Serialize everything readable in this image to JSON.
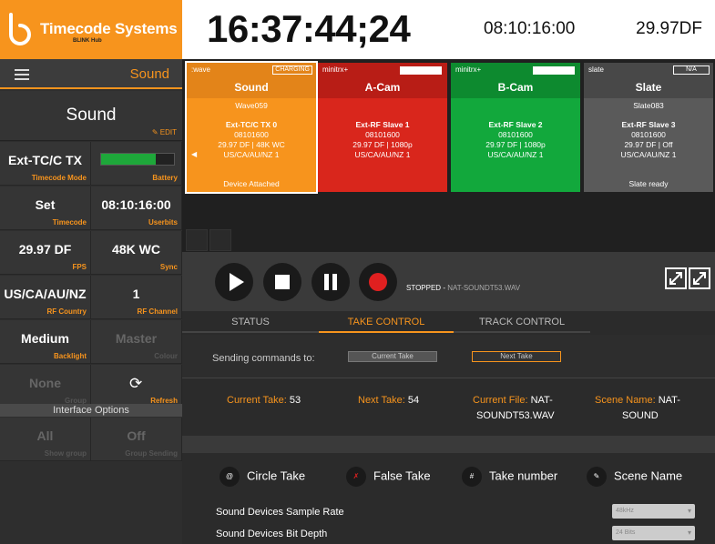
{
  "brand": {
    "name": "Timecode Systems",
    "sub": "BLINK Hub",
    "color": "#f7941d"
  },
  "header": {
    "menu_title": "Sound"
  },
  "device": {
    "name": "Sound",
    "edit_label": "✎ EDIT"
  },
  "settings": [
    {
      "value": "Ext-TC/C TX",
      "label": "Timecode Mode"
    },
    {
      "value": "",
      "label": "Battery",
      "battery_level": 0.75
    },
    {
      "value": "Set",
      "label": "Timecode"
    },
    {
      "value": "08:10:16:00",
      "label": "Userbits"
    },
    {
      "value": "29.97 DF",
      "label": "FPS"
    },
    {
      "value": "48K WC",
      "label": "Sync"
    },
    {
      "value": "US/CA/AU/NZ",
      "label": "RF Country"
    },
    {
      "value": "1",
      "label": "RF Channel"
    },
    {
      "value": "Medium",
      "label": "Backlight"
    },
    {
      "value": "Master",
      "label": "Colour"
    },
    {
      "value": "None",
      "label": "Group"
    },
    {
      "value": "",
      "label": "Refresh"
    },
    {
      "value": "All",
      "label": "Show group"
    },
    {
      "value": "Off",
      "label": "Group Sending"
    }
  ],
  "interface_options_label": "Interface Options",
  "clock": {
    "timecode": "16:37:44;24",
    "userbits": "08:10:16:00",
    "fps": "29.97DF"
  },
  "tiles": [
    {
      "model": ":wave",
      "badge": "CHARGING",
      "name": "Sound",
      "serial": "Wave059",
      "mode": "Ext-TC/C TX 0",
      "ub": "08101600",
      "fmt": "29.97 DF | 48K WC",
      "region": "US/CA/AU/NZ 1",
      "foot": "Device Attached",
      "color": "#f7941d",
      "head_color": "#e38419"
    },
    {
      "model": "minitrx+",
      "badge": "",
      "name": "A-Cam",
      "serial": "",
      "mode": "Ext-RF Slave 1",
      "ub": "08101600",
      "fmt": "29.97 DF | 1080p",
      "region": "US/CA/AU/NZ 1",
      "foot": "",
      "color": "#d9261c",
      "head_color": "#b81d16"
    },
    {
      "model": "minitrx+",
      "badge": "",
      "name": "B-Cam",
      "serial": "",
      "mode": "Ext-RF Slave 2",
      "ub": "08101600",
      "fmt": "29.97 DF | 1080p",
      "region": "US/CA/AU/NZ 1",
      "foot": "",
      "color": "#12a83c",
      "head_color": "#0d8a2f"
    },
    {
      "model": "slate",
      "badge": "N/A",
      "name": "Slate",
      "serial": "Slate083",
      "mode": "Ext-RF Slave 3",
      "ub": "08101600",
      "fmt": "29.97 DF | Off",
      "region": "US/CA/AU/NZ 1",
      "foot": "Slate ready",
      "color": "#5a5a5a",
      "head_color": "#484848"
    }
  ],
  "transport": {
    "status": "STOPPED",
    "file": "NAT-SOUNDT53.WAV"
  },
  "tabs": [
    "STATUS",
    "TAKE CONTROL",
    "TRACK CONTROL"
  ],
  "send": {
    "label": "Sending commands to:",
    "current": "Current Take",
    "next": "Next Take"
  },
  "take": {
    "current_label": "Current Take:",
    "current_value": "53",
    "next_label": "Next Take:",
    "next_value": "54",
    "file_label": "Current File:",
    "file_value_a": "NAT-",
    "file_value_b": "SOUNDT53.WAV",
    "scene_label": "Scene Name:",
    "scene_value_a": "NAT-",
    "scene_value_b": "SOUND"
  },
  "actions": [
    "Circle Take",
    "False Take",
    "Take number",
    "Scene Name"
  ],
  "device_settings": [
    {
      "label": "Sound Devices Sample Rate",
      "value": "48kHz"
    },
    {
      "label": "Sound Devices Bit Depth",
      "value": "24 Bits"
    }
  ]
}
